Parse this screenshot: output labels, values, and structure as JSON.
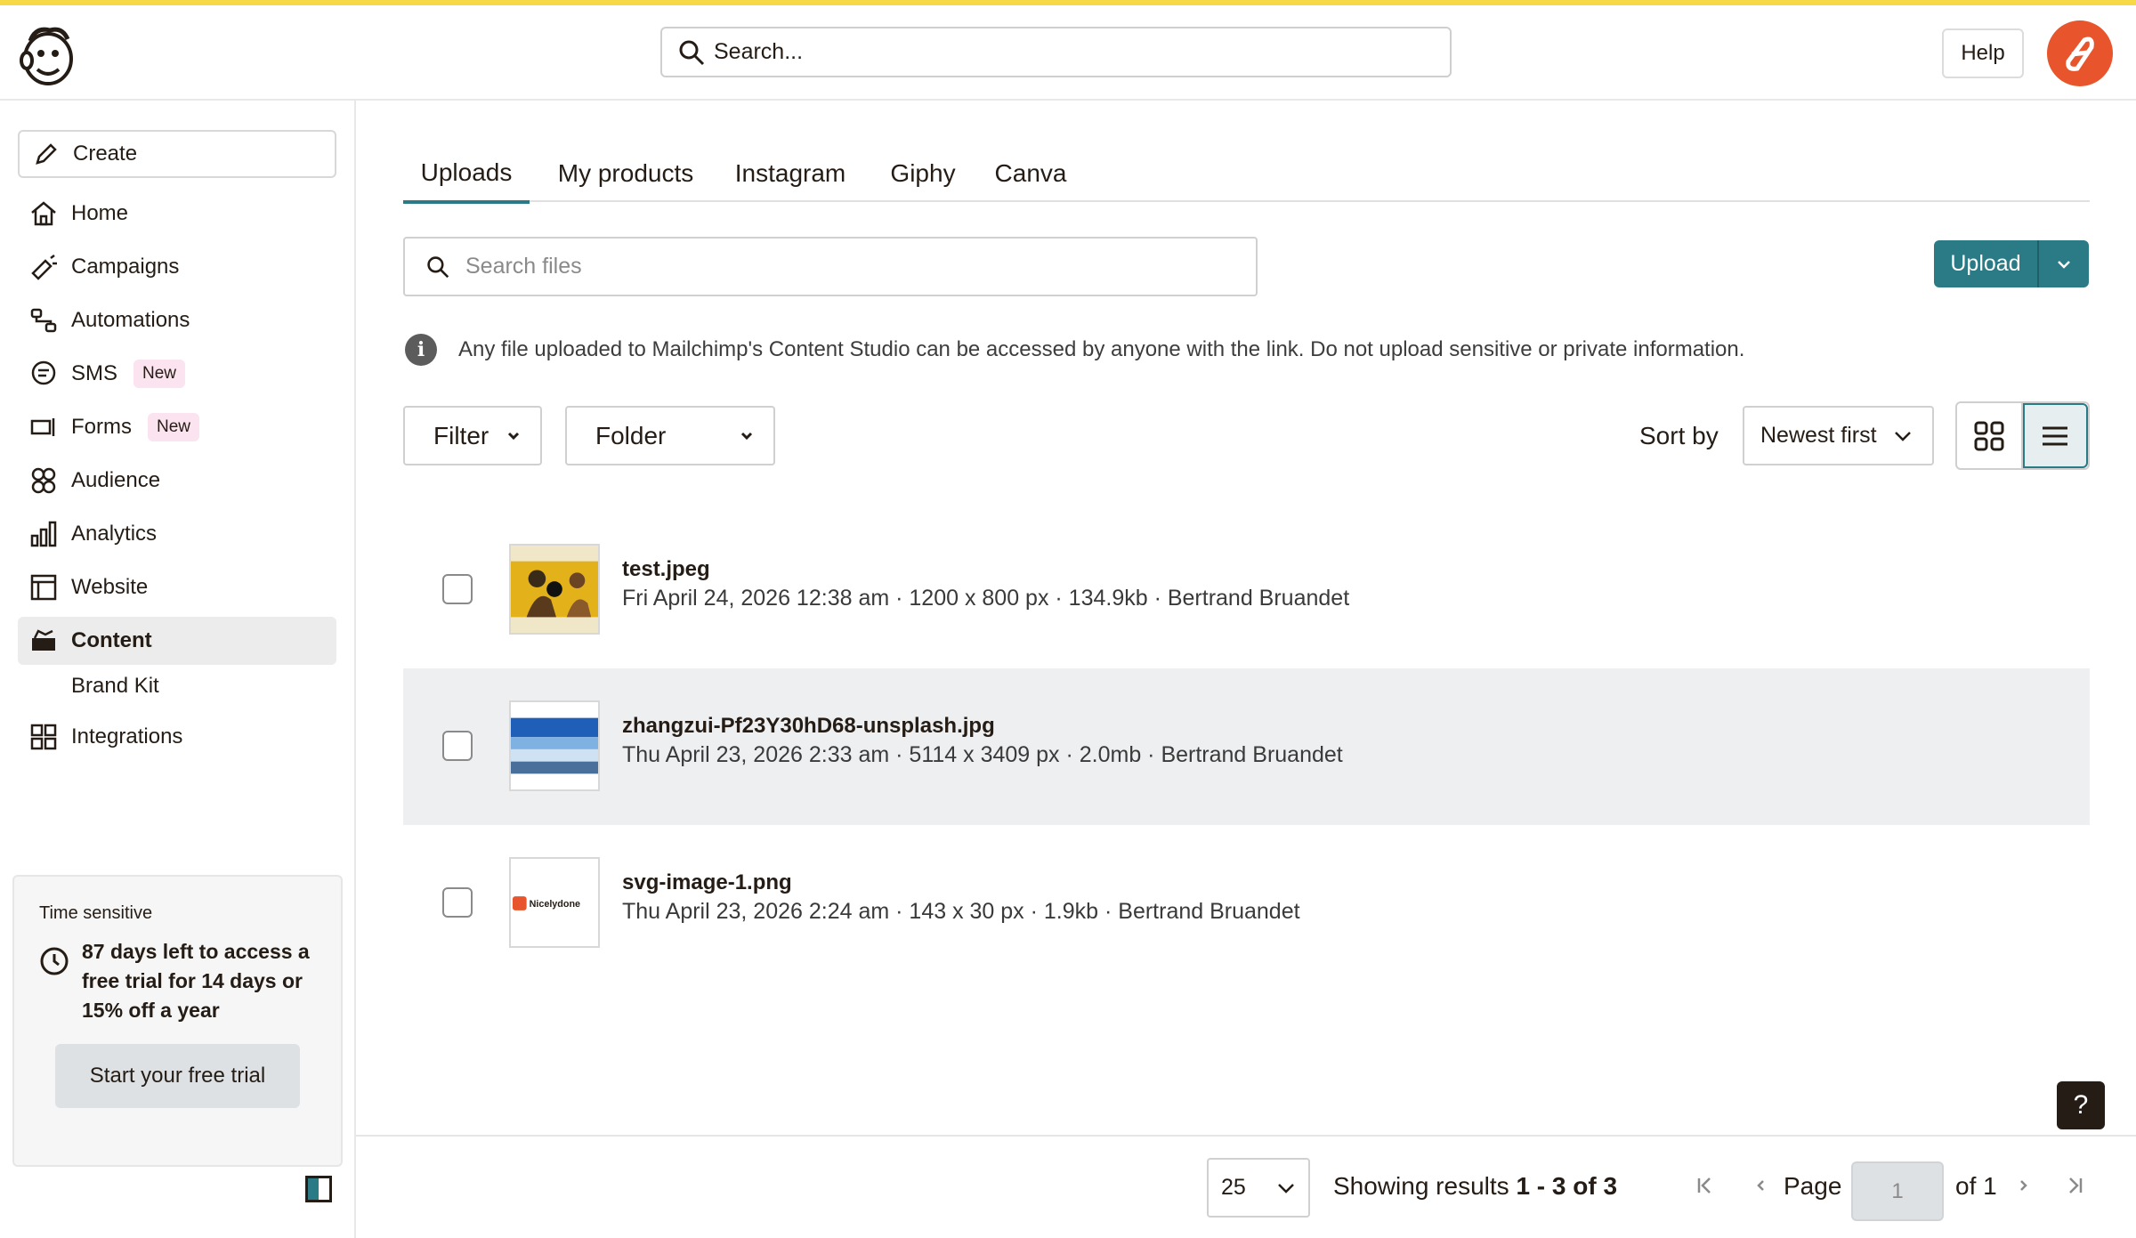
{
  "header": {
    "search_placeholder": "Search...",
    "help_label": "Help"
  },
  "sidebar": {
    "create_label": "Create",
    "items": [
      {
        "label": "Home",
        "icon": "home-icon"
      },
      {
        "label": "Campaigns",
        "icon": "megaphone-icon"
      },
      {
        "label": "Automations",
        "icon": "automation-icon"
      },
      {
        "label": "SMS",
        "icon": "sms-icon",
        "badge": "New"
      },
      {
        "label": "Forms",
        "icon": "forms-icon",
        "badge": "New"
      },
      {
        "label": "Audience",
        "icon": "audience-icon"
      },
      {
        "label": "Analytics",
        "icon": "analytics-icon"
      },
      {
        "label": "Website",
        "icon": "website-icon"
      },
      {
        "label": "Content",
        "icon": "content-icon",
        "active": true
      },
      {
        "label": "Integrations",
        "icon": "integrations-icon"
      }
    ],
    "sub_item": "Brand Kit",
    "trial": {
      "title": "Time sensitive",
      "text": "87 days left to access a free trial for 14 days or 15% off a year",
      "button": "Start your free trial"
    }
  },
  "tabs": [
    "Uploads",
    "My products",
    "Instagram",
    "Giphy",
    "Canva"
  ],
  "active_tab": "Uploads",
  "file_search_placeholder": "Search files",
  "upload_label": "Upload",
  "notice": "Any file uploaded to Mailchimp's Content Studio can be accessed by anyone with the link. Do not upload sensitive or private information.",
  "filters": {
    "filter_label": "Filter",
    "folder_label": "Folder",
    "sort_by_label": "Sort by",
    "sort_value": "Newest first"
  },
  "files": [
    {
      "name": "test.jpeg",
      "meta": "Fri April 24, 2026 12:38 am · 1200 x 800 px · 134.9kb · Bertrand Bruandet",
      "thumb": "yellow-photo"
    },
    {
      "name": "zhangzui-Pf23Y30hD68-unsplash.jpg",
      "meta": "Thu April 23, 2026 2:33 am · 5114 x 3409 px · 2.0mb · Bertrand Bruandet",
      "thumb": "sky-photo"
    },
    {
      "name": "svg-image-1.png",
      "meta": "Thu April 23, 2026 2:24 am · 143 x 30 px · 1.9kb · Bertrand Bruandet",
      "thumb": "logo",
      "thumb_text": "Nicelydone"
    }
  ],
  "footer": {
    "per_page": "25",
    "showing_prefix": "Showing results ",
    "showing_range": "1 - 3 of 3",
    "page_label": "Page",
    "page_value": "1",
    "of_label": "of 1"
  },
  "help_fab": "?",
  "colors": {
    "accent": "#2a7b86",
    "topline": "#f7d948",
    "avatar": "#e8542b"
  }
}
